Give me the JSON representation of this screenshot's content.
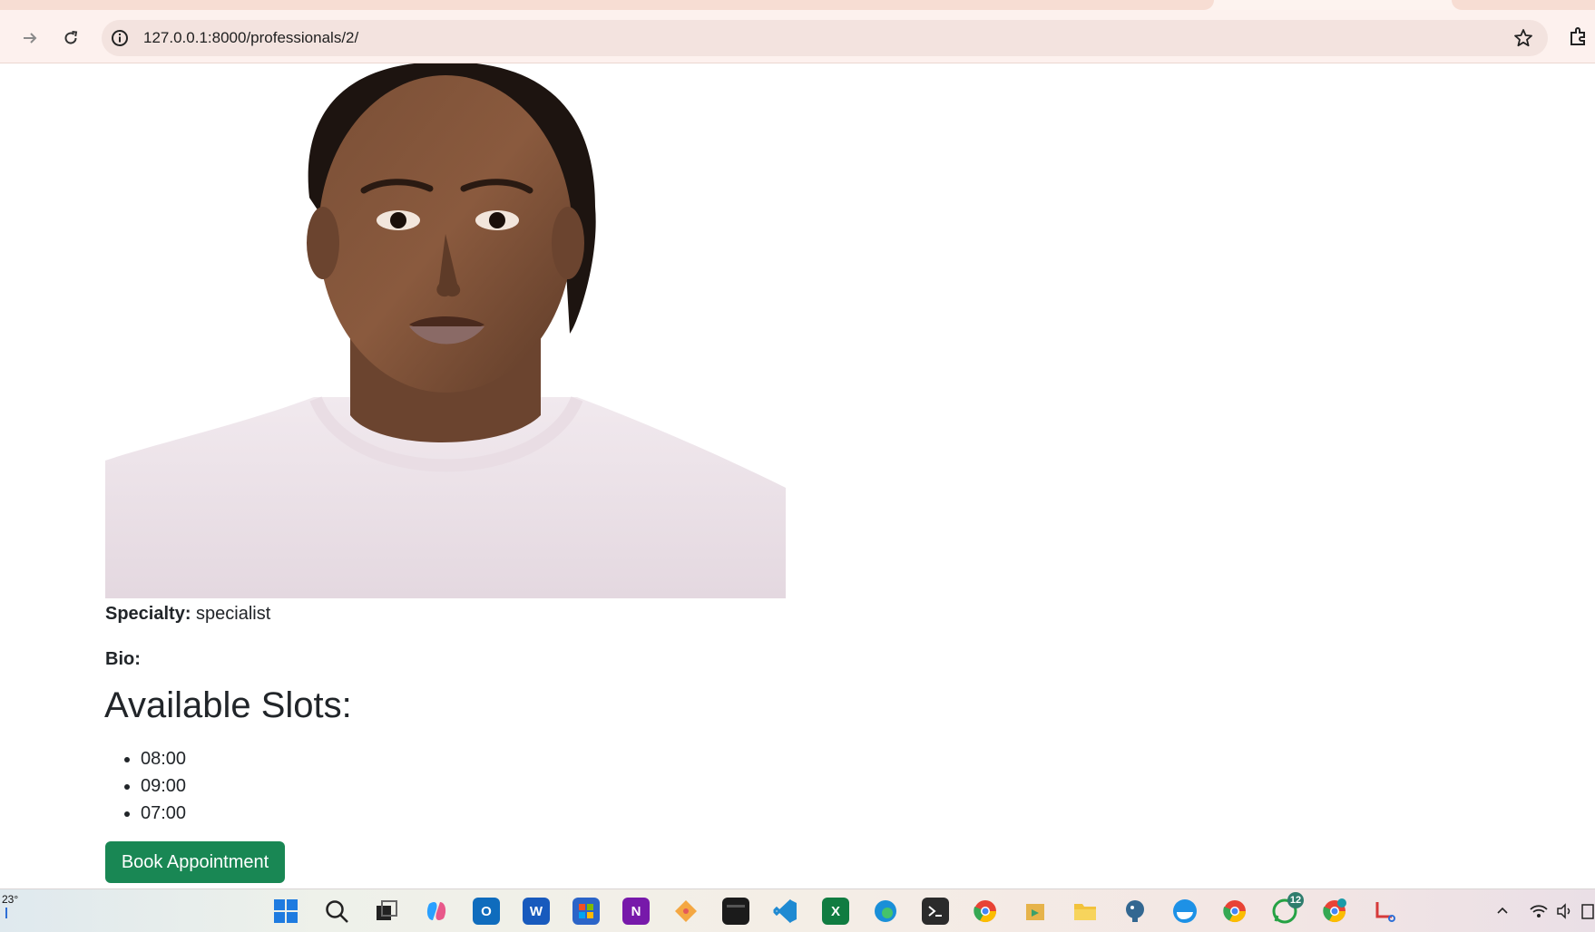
{
  "browser": {
    "url": "127.0.0.1:8000/professionals/2/"
  },
  "professional": {
    "photo_alt": "",
    "specialty_label": "Specialty:",
    "specialty_value": "specialist",
    "bio_label": "Bio:",
    "slots_heading": "Available Slots:",
    "slots": [
      "08:00",
      "09:00",
      "07:00"
    ],
    "book_button_label": "Book Appointment"
  },
  "taskbar": {
    "weather_temp": "23°",
    "icons": [
      "windows-start-icon",
      "search-icon",
      "task-view-icon",
      "copilot-icon",
      "outlook-icon",
      "word-icon",
      "store-icon",
      "onenote-icon",
      "git-icon",
      "terminal-icon",
      "vscode-icon",
      "excel-icon",
      "edge-icon",
      "powershell-icon",
      "chrome-icon",
      "files-icon",
      "file-explorer-icon",
      "postgres-icon",
      "docker-icon",
      "chrome-profile-icon",
      "whatsapp-icon",
      "chrome-beta-icon",
      "snipping-tool-icon"
    ],
    "whatsapp_badge": "12",
    "tray": [
      "chevron-up-icon",
      "wifi-icon",
      "volume-icon",
      "battery-icon"
    ]
  },
  "colors": {
    "button": "#198754",
    "text": "#212529",
    "chrome_bg": "#fdf1ee",
    "omnibox_bg": "#f3e3df"
  }
}
